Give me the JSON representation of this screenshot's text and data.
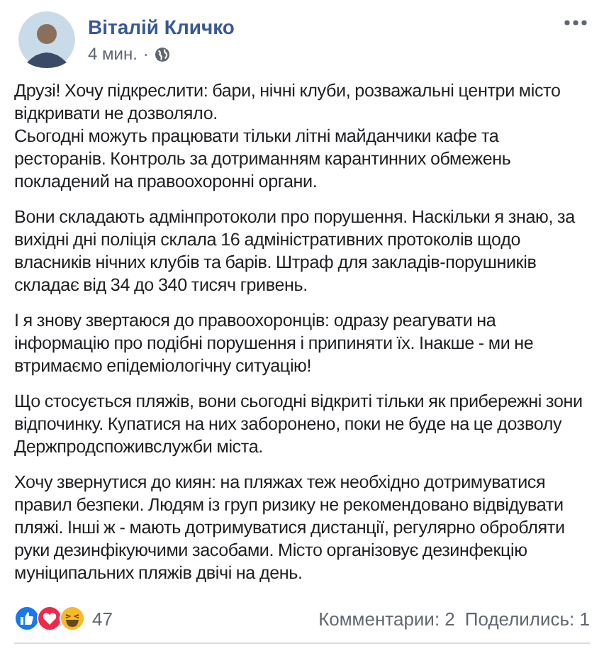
{
  "post": {
    "author": "Віталій Кличко",
    "time": "4 мин.",
    "separator": "·",
    "paragraphs": [
      "Друзі! Хочу підкреслити: бари, нічні клуби, розважальні центри місто відкривати не дозволяло.\nСьогодні можуть працювати тільки літні майданчики кафе та ресторанів. Контроль за дотриманням карантинних обмежень покладений на правоохоронні органи.",
      "Вони складають адмінпротоколи про порушення. Наскільки я знаю, за вихідні дні поліція склала 16 адміністративних протоколів щодо власників нічних клубів та барів. Штраф для закладів-порушників складає від 34 до 340 тисяч гривень.",
      "І я знову звертаюся до правоохоронців: одразу реагувати на інформацію про подібні порушення і припиняти їх. Інакше - ми не втримаємо епідеміологічну ситуацію!",
      "Що стосується пляжів, вони сьогодні відкриті тільки як прибережні зони відпочинку. Купатися на них заборонено, поки не буде на це дозволу Держпродспоживслужби міста.",
      "Хочу звернутися до киян: на пляжах теж необхідно дотримуватися правил безпеки. Людям із груп ризику не рекомендовано відвідувати пляжі. Інші ж - мають дотримуватися дистанції, регулярно обробляти руки дезинфікуючими засобами. Місто організовує дезинфекцію муніципальних пляжів двічі на день."
    ]
  },
  "reactions": {
    "items": [
      {
        "kind": "like"
      },
      {
        "kind": "love"
      },
      {
        "kind": "haha"
      }
    ],
    "count": "47",
    "comments": "Комментарии: 2",
    "shares": "Поделились: 1"
  }
}
